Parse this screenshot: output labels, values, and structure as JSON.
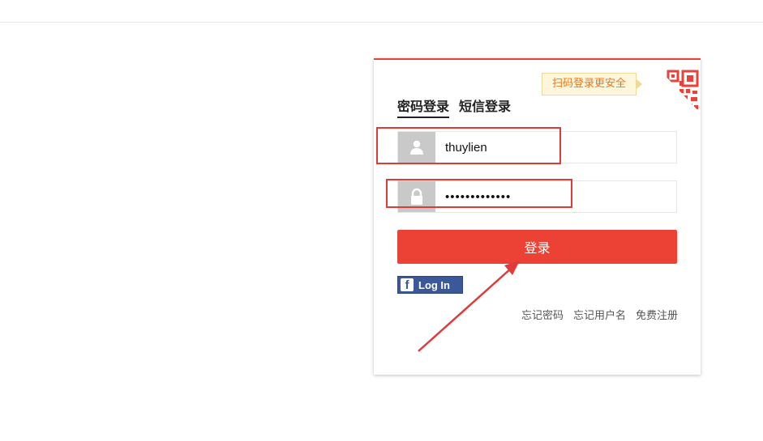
{
  "login": {
    "qr_hint": "扫码登录更安全",
    "tabs": [
      {
        "label": "密码登录",
        "active": true
      },
      {
        "label": "短信登录",
        "active": false
      }
    ],
    "username_value": "thuylien",
    "password_value": "•••••••••••••",
    "submit_label": "登录",
    "facebook_label": "Log In",
    "facebook_logo": "f",
    "links": [
      "忘记密码",
      "忘记用户名",
      "免费注册"
    ]
  },
  "colors": {
    "accent": "#ec4135",
    "annotation": "#e03a3a",
    "facebook": "#3b5998",
    "hint_text": "#e8771e"
  },
  "icons": [
    "user-icon",
    "lock-icon",
    "qr-code-icon",
    "facebook-logo-icon"
  ]
}
